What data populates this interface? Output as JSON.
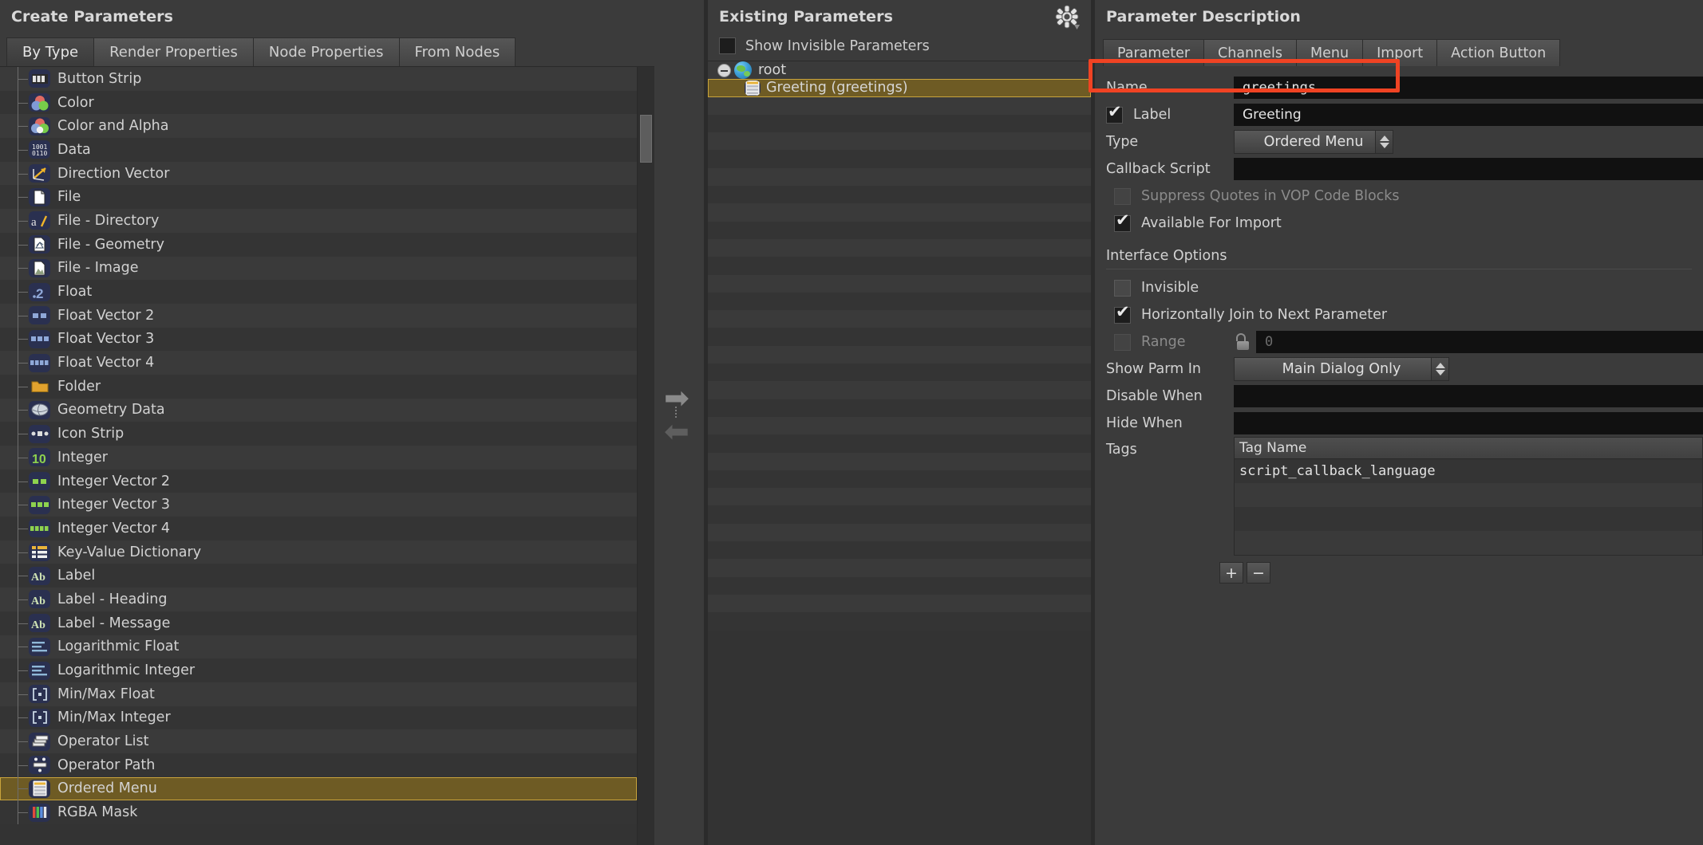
{
  "left_panel": {
    "title": "Create Parameters",
    "tabs": [
      {
        "label": "By Type",
        "active": true
      },
      {
        "label": "Render Properties",
        "active": false
      },
      {
        "label": "Node Properties",
        "active": false
      },
      {
        "label": "From Nodes",
        "active": false
      }
    ],
    "types": [
      {
        "label": "Button Strip",
        "icon": "button-strip-icon",
        "selected": false
      },
      {
        "label": "Color",
        "icon": "color-icon",
        "selected": false
      },
      {
        "label": "Color and Alpha",
        "icon": "color-alpha-icon",
        "selected": false
      },
      {
        "label": "Data",
        "icon": "data-icon",
        "selected": false
      },
      {
        "label": "Direction Vector",
        "icon": "direction-vector-icon",
        "selected": false
      },
      {
        "label": "File",
        "icon": "file-icon",
        "selected": false
      },
      {
        "label": "File - Directory",
        "icon": "file-directory-icon",
        "selected": false
      },
      {
        "label": "File - Geometry",
        "icon": "file-geometry-icon",
        "selected": false
      },
      {
        "label": "File - Image",
        "icon": "file-image-icon",
        "selected": false
      },
      {
        "label": "Float",
        "icon": "float-icon",
        "selected": false
      },
      {
        "label": "Float Vector 2",
        "icon": "float-vector2-icon",
        "selected": false
      },
      {
        "label": "Float Vector 3",
        "icon": "float-vector3-icon",
        "selected": false
      },
      {
        "label": "Float Vector 4",
        "icon": "float-vector4-icon",
        "selected": false
      },
      {
        "label": "Folder",
        "icon": "folder-icon",
        "selected": false
      },
      {
        "label": "Geometry Data",
        "icon": "geometry-data-icon",
        "selected": false
      },
      {
        "label": "Icon Strip",
        "icon": "icon-strip-icon",
        "selected": false
      },
      {
        "label": "Integer",
        "icon": "integer-icon",
        "selected": false
      },
      {
        "label": "Integer Vector 2",
        "icon": "integer-vector2-icon",
        "selected": false
      },
      {
        "label": "Integer Vector 3",
        "icon": "integer-vector3-icon",
        "selected": false
      },
      {
        "label": "Integer Vector 4",
        "icon": "integer-vector4-icon",
        "selected": false
      },
      {
        "label": "Key-Value Dictionary",
        "icon": "key-value-dictionary-icon",
        "selected": false
      },
      {
        "label": "Label",
        "icon": "label-icon",
        "selected": false
      },
      {
        "label": "Label - Heading",
        "icon": "label-heading-icon",
        "selected": false
      },
      {
        "label": "Label - Message",
        "icon": "label-message-icon",
        "selected": false
      },
      {
        "label": "Logarithmic Float",
        "icon": "log-float-icon",
        "selected": false
      },
      {
        "label": "Logarithmic Integer",
        "icon": "log-integer-icon",
        "selected": false
      },
      {
        "label": "Min/Max Float",
        "icon": "minmax-float-icon",
        "selected": false
      },
      {
        "label": "Min/Max Integer",
        "icon": "minmax-integer-icon",
        "selected": false
      },
      {
        "label": "Operator List",
        "icon": "operator-list-icon",
        "selected": false
      },
      {
        "label": "Operator Path",
        "icon": "operator-path-icon",
        "selected": false
      },
      {
        "label": "Ordered Menu",
        "icon": "ordered-menu-icon",
        "selected": true
      },
      {
        "label": "RGBA Mask",
        "icon": "rgba-mask-icon",
        "selected": false
      }
    ]
  },
  "middle_panel": {
    "title": "Existing Parameters",
    "show_invisible_label": "Show Invisible Parameters",
    "show_invisible_checked": false,
    "tree": [
      {
        "label": "root",
        "icon": "globe-icon",
        "selected": false,
        "depth": 0
      },
      {
        "label": "Greeting (greetings)",
        "icon": "ordered-menu-icon",
        "selected": true,
        "depth": 1
      }
    ]
  },
  "right_panel": {
    "title": "Parameter Description",
    "tabs": [
      {
        "label": "Parameter",
        "active": true
      },
      {
        "label": "Channels",
        "active": false
      },
      {
        "label": "Menu",
        "active": false
      },
      {
        "label": "Import",
        "active": false
      },
      {
        "label": "Action Button",
        "active": false
      }
    ],
    "fields": {
      "name_label": "Name",
      "name_value": "greetings",
      "label_label": "Label",
      "label_value": "Greeting",
      "label_checked": true,
      "type_label": "Type",
      "type_value": "Ordered Menu",
      "callback_label": "Callback Script",
      "callback_value": "",
      "suppress_quotes_label": "Suppress Quotes in VOP Code Blocks",
      "suppress_quotes_checked": false,
      "suppress_quotes_disabled": true,
      "available_import_label": "Available For Import",
      "available_import_checked": true,
      "interface_options_heading": "Interface Options",
      "invisible_label": "Invisible",
      "invisible_checked": false,
      "horiz_join_label": "Horizontally Join to Next Parameter",
      "horiz_join_checked": true,
      "range_label": "Range",
      "range_checked": false,
      "range_disabled": true,
      "range_value": "0",
      "show_parm_in_label": "Show Parm In",
      "show_parm_in_value": "Main Dialog Only",
      "disable_when_label": "Disable When",
      "disable_when_value": "",
      "hide_when_label": "Hide When",
      "hide_when_value": "",
      "tags_label": "Tags",
      "tags_header": "Tag Name",
      "tags_rows": [
        "script_callback_language",
        "",
        "",
        ""
      ],
      "tag_add_label": "+",
      "tag_remove_label": "−"
    }
  },
  "annotation": {
    "color": "#f04323",
    "target": "type-row"
  }
}
